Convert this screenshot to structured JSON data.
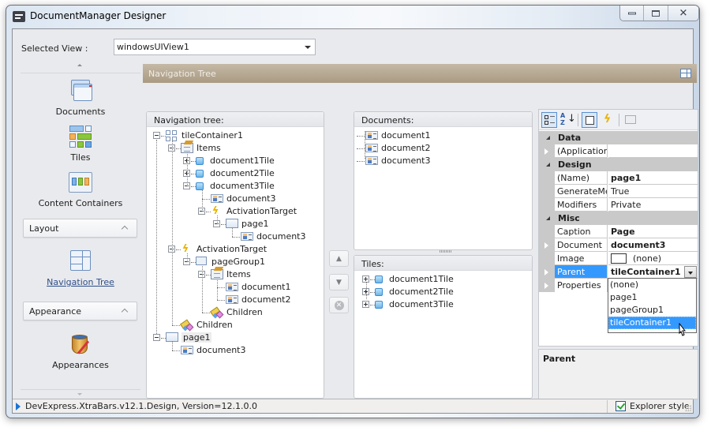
{
  "window": {
    "title": "DocumentManager Designer",
    "controls": [
      "minimize",
      "maximize",
      "close"
    ]
  },
  "selected_view": {
    "label": "Selected View :",
    "value": "windowsUIView1"
  },
  "sidebar": {
    "items": [
      {
        "label": "Documents",
        "icon": "documents-icon"
      },
      {
        "label": "Tiles",
        "icon": "tiles-icon"
      },
      {
        "label": "Content Containers",
        "icon": "content-containers-icon"
      }
    ],
    "groups": [
      {
        "label": "Layout",
        "items": [
          {
            "label": "Navigation Tree",
            "icon": "navigation-tree-icon",
            "selected": true
          }
        ]
      },
      {
        "label": "Appearance",
        "items": [
          {
            "label": "Appearances",
            "icon": "appearances-icon"
          }
        ]
      }
    ]
  },
  "header": {
    "title": "Navigation Tree"
  },
  "navigation_tree": {
    "title": "Navigation tree:",
    "nodes": [
      {
        "label": "tileContainer1",
        "icon": "tile-container-icon",
        "depth": 0,
        "expander": "minus"
      },
      {
        "label": "Items",
        "icon": "items-icon",
        "depth": 1,
        "expander": "minus"
      },
      {
        "label": "document1Tile",
        "icon": "tile-icon",
        "depth": 2,
        "expander": "plus"
      },
      {
        "label": "document2Tile",
        "icon": "tile-icon",
        "depth": 2,
        "expander": "plus"
      },
      {
        "label": "document3Tile",
        "icon": "tile-icon",
        "depth": 2,
        "expander": "minus"
      },
      {
        "label": "document3",
        "icon": "document-icon",
        "depth": 3,
        "expander": "none"
      },
      {
        "label": "ActivationTarget",
        "icon": "activation-icon",
        "depth": 3,
        "expander": "minus"
      },
      {
        "label": "page1",
        "icon": "page-icon",
        "depth": 4,
        "expander": "minus"
      },
      {
        "label": "document3",
        "icon": "document-icon",
        "depth": 5,
        "expander": "none"
      },
      {
        "label": "ActivationTarget",
        "icon": "activation-icon",
        "depth": 1,
        "expander": "minus"
      },
      {
        "label": "pageGroup1",
        "icon": "page-group-icon",
        "depth": 2,
        "expander": "minus"
      },
      {
        "label": "Items",
        "icon": "items-icon",
        "depth": 3,
        "expander": "minus"
      },
      {
        "label": "document1",
        "icon": "document-icon",
        "depth": 4,
        "expander": "none"
      },
      {
        "label": "document2",
        "icon": "document-icon",
        "depth": 4,
        "expander": "none"
      },
      {
        "label": "Children",
        "icon": "children-icon",
        "depth": 3,
        "expander": "none"
      },
      {
        "label": "Children",
        "icon": "children-icon",
        "depth": 1,
        "expander": "none"
      },
      {
        "label": "page1",
        "icon": "page-icon",
        "depth": 0,
        "expander": "minus",
        "selected": true
      },
      {
        "label": "document3",
        "icon": "document-icon",
        "depth": 1,
        "expander": "none"
      }
    ]
  },
  "documents_list": {
    "title": "Documents:",
    "items": [
      "document1",
      "document2",
      "document3"
    ]
  },
  "tiles_list": {
    "title": "Tiles:",
    "items": [
      "document1Tile",
      "document2Tile",
      "document3Tile"
    ]
  },
  "move_buttons": [
    "move-up",
    "move-down",
    "remove"
  ],
  "property_grid": {
    "toolbar": [
      "categorized",
      "alphabetical",
      "properties",
      "events",
      "property-pages"
    ],
    "rows": [
      {
        "type": "category",
        "name": "Data"
      },
      {
        "type": "property",
        "name": "(ApplicationS",
        "value": "",
        "expandable": true
      },
      {
        "type": "category",
        "name": "Design"
      },
      {
        "type": "property",
        "name": "(Name)",
        "value": "page1",
        "bold": true
      },
      {
        "type": "property",
        "name": "GenerateMer",
        "value": "True"
      },
      {
        "type": "property",
        "name": "Modifiers",
        "value": "Private"
      },
      {
        "type": "category",
        "name": "Misc"
      },
      {
        "type": "property",
        "name": "Caption",
        "value": "Page",
        "bold": true
      },
      {
        "type": "property",
        "name": "Document",
        "value": "document3",
        "bold": true,
        "expandable": true
      },
      {
        "type": "property",
        "name": "Image",
        "value": "(none)",
        "image": true
      },
      {
        "type": "property",
        "name": "Parent",
        "value": "tileContainer1",
        "bold": true,
        "expandable": true,
        "selected": true,
        "dropdown": true
      },
      {
        "type": "property",
        "name": "Properties",
        "value": "",
        "expandable": true
      }
    ],
    "dropdown_options": [
      "(none)",
      "page1",
      "pageGroup1",
      "tileContainer1"
    ],
    "dropdown_selected": "tileContainer1",
    "help_title": "Parent"
  },
  "statusbar": {
    "text": "DevExpress.XtraBars.v12.1.Design, Version=12.1.0.0",
    "explorer_style_label": "Explorer style",
    "explorer_style_checked": true
  }
}
